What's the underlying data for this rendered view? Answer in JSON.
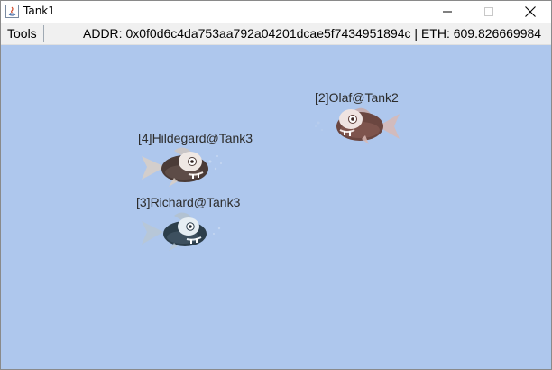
{
  "window": {
    "title": "Tank1",
    "minimize_icon": "minimize-icon",
    "maximize_icon": "maximize-icon",
    "close_icon": "close-icon"
  },
  "menubar": {
    "tools_label": "Tools",
    "status": "ADDR: 0x0f0d6c4da753aa792a04201dcae5f7434951894c | ETH: 609.826669984"
  },
  "tank": {
    "background": "#aec7ed",
    "fish": [
      {
        "label": "[2]Olaf@Tank2",
        "color": "#6a4a44",
        "direction": "left"
      },
      {
        "label": "[4]Hildegard@Tank3",
        "color": "#4e3f3a",
        "direction": "left"
      },
      {
        "label": "[3]Richard@Tank3",
        "color": "#2e3f4a",
        "direction": "left"
      }
    ]
  }
}
